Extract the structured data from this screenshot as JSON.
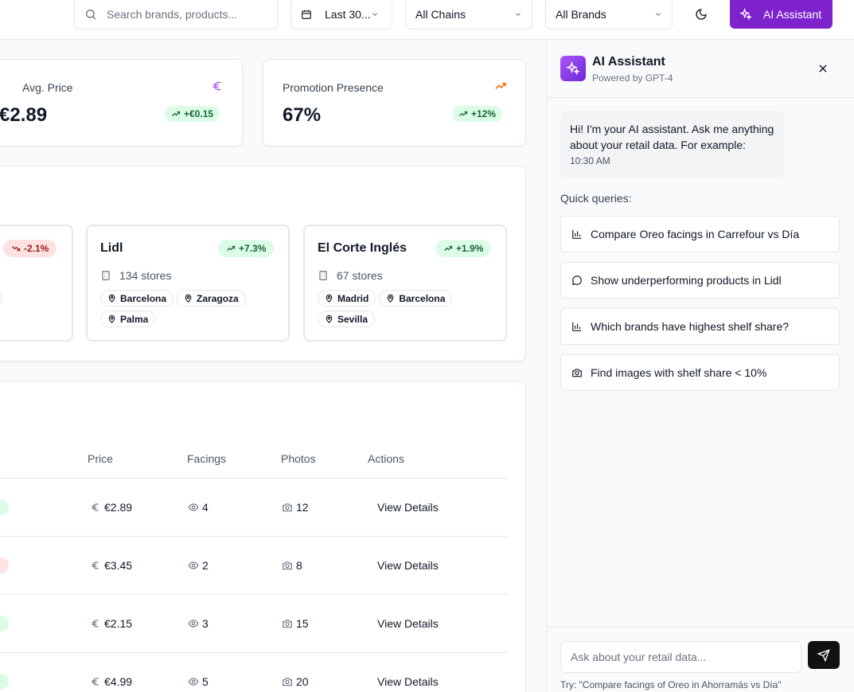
{
  "header": {
    "search_placeholder": "Search brands, products...",
    "date_select": "Last 30...",
    "chains_select": "All Chains",
    "brands_select": "All Brands",
    "ai_button": "AI Assistant"
  },
  "kpis": [
    {
      "label": "Avg. Price",
      "value": "€2.89",
      "change": "+€0.15",
      "icon": "euro-icon",
      "icon_color": "#a855f7"
    },
    {
      "label": "Promotion Presence",
      "value": "67%",
      "change": "+12%",
      "icon": "trending-up-icon",
      "icon_color": "#f97316"
    }
  ],
  "chains": [
    {
      "name": "",
      "change": "-2.1%",
      "trend": "down",
      "stores": "",
      "cities": []
    },
    {
      "name": "Lidl",
      "change": "+7.3%",
      "trend": "up",
      "stores": "134 stores",
      "cities": [
        "Barcelona",
        "Zaragoza",
        "Palma"
      ]
    },
    {
      "name": "El Corte Inglés",
      "change": "+1.9%",
      "trend": "up",
      "stores": "67 stores",
      "cities": [
        "Madrid",
        "Barcelona",
        "Sevilla"
      ]
    }
  ],
  "table": {
    "headers": {
      "price": "Price",
      "facings": "Facings",
      "photos": "Photos",
      "actions": "Actions"
    },
    "rows": [
      {
        "status": "green",
        "price": "€2.89",
        "facings": "4",
        "photos": "12",
        "action": "View Details"
      },
      {
        "status": "red",
        "price": "€3.45",
        "facings": "2",
        "photos": "8",
        "action": "View Details"
      },
      {
        "status": "green",
        "price": "€2.15",
        "facings": "3",
        "photos": "15",
        "action": "View Details"
      },
      {
        "status": "green",
        "price": "€4.99",
        "facings": "5",
        "photos": "20",
        "action": "View Details"
      }
    ]
  },
  "ai_panel": {
    "title": "AI Assistant",
    "subtitle": "Powered by GPT-4",
    "greeting": "Hi! I'm your AI assistant. Ask me anything about your retail data. For example:",
    "greeting_time": "10:30 AM",
    "quick_label": "Quick queries:",
    "quick_queries": [
      {
        "text": "Compare Oreo facings in Carrefour vs Día",
        "icon": "bar-chart-icon"
      },
      {
        "text": "Show underperforming products in Lidl",
        "icon": "message-circle-icon"
      },
      {
        "text": "Which brands have highest shelf share?",
        "icon": "bar-chart-icon"
      },
      {
        "text": "Find images with shelf share < 10%",
        "icon": "camera-icon"
      }
    ],
    "input_placeholder": "Ask about your retail data...",
    "hint": "Try: \"Compare facings of Oreo in Ahorramás vs Día\""
  },
  "colors": {
    "accent": "#7e22ce",
    "positive_bg": "#dcfce7",
    "positive_fg": "#166534",
    "negative_bg": "#fee2e2",
    "negative_fg": "#991b1b"
  }
}
